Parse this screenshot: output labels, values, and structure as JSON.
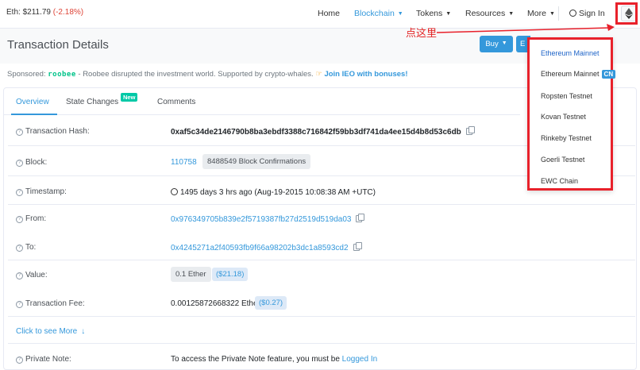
{
  "topbar": {
    "eth_label": "Eth: $211.79",
    "eth_change": "(-2.18%)",
    "nav": {
      "home": "Home",
      "blockchain": "Blockchain",
      "tokens": "Tokens",
      "resources": "Resources",
      "more": "More",
      "sign_in": "Sign In"
    }
  },
  "page": {
    "title": "Transaction Details",
    "buy_label": "Buy",
    "exchange_label": "E"
  },
  "sponsored": {
    "prefix": "Sponsored:",
    "brand": "roobee",
    "text": "- Roobee disrupted the investment world. Supported by crypto-whales.",
    "promo": "Join IEO with bonuses!"
  },
  "tabs": {
    "overview": "Overview",
    "state_changes": "State Changes",
    "new_badge": "New",
    "comments": "Comments"
  },
  "details": {
    "tx_hash": {
      "label": "Transaction Hash:",
      "value": "0xaf5c34de2146790b8ba3ebdf3388c716842f59bb3df741da4ee15d4b8d53c6db"
    },
    "block": {
      "label": "Block:",
      "value": "110758",
      "confirmations": "8488549 Block Confirmations"
    },
    "timestamp": {
      "label": "Timestamp:",
      "value": "1495 days 3 hrs ago (Aug-19-2015 10:08:38 AM +UTC)"
    },
    "from": {
      "label": "From:",
      "value": "0x976349705b839e2f5719387fb27d2519d519da03"
    },
    "to": {
      "label": "To:",
      "value": "0x4245271a2f40593fb9f66a98202b3dc1a8593cd2"
    },
    "value": {
      "label": "Value:",
      "amount": "0.1 Ether",
      "usd": "($21.18)"
    },
    "fee": {
      "label": "Transaction Fee:",
      "amount": "0.00125872668322 Ether",
      "usd": "($0.27)"
    },
    "see_more": "Click to see More",
    "private_note": {
      "label": "Private Note:",
      "text": "To access the Private Note feature, you must be",
      "link": "Logged In"
    }
  },
  "annotation": "点这里",
  "network_menu": {
    "items": [
      {
        "label": "Ethereum Mainnet"
      },
      {
        "label": "Ethereum Mainnet",
        "badge": "CN"
      },
      {
        "label": "Ropsten Testnet"
      },
      {
        "label": "Kovan Testnet"
      },
      {
        "label": "Rinkeby Testnet"
      },
      {
        "label": "Goerli Testnet"
      },
      {
        "label": "EWC Chain"
      }
    ]
  },
  "colors": {
    "accent": "#3498db",
    "annotation_red": "#e8212b",
    "negative": "#de4437"
  }
}
